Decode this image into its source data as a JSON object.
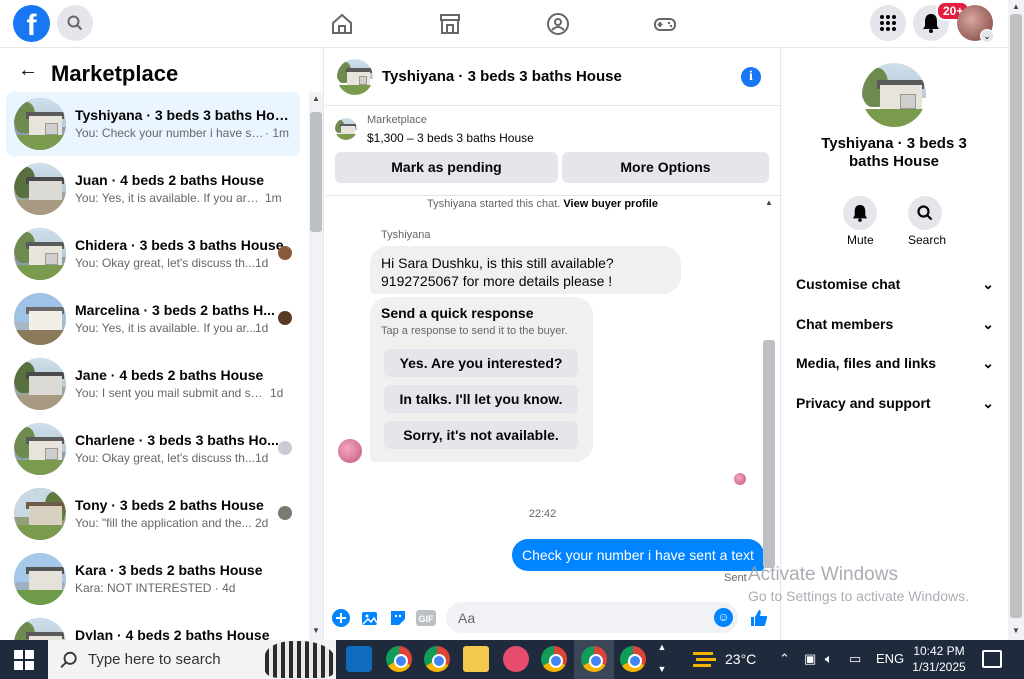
{
  "topbar": {
    "logo_letter": "f",
    "notifications_badge": "20+"
  },
  "left": {
    "title": "Marketplace",
    "conversations": [
      {
        "title": "Tyshiyana · 3 beds 3 baths House",
        "preview": "You: Check your number i have se...",
        "time": "· 1m"
      },
      {
        "title": "Juan · 4 beds 2 baths House",
        "preview": "You: Yes, it is available. If you are i...",
        "time": "1m"
      },
      {
        "title": "Chidera · 3 beds 3 baths House",
        "preview": "You: Okay great, let's discuss th...",
        "time": "1d"
      },
      {
        "title": "Marcelina · 3 beds 2 baths H...",
        "preview": "You: Yes, it is available. If you ar...",
        "time": "1d"
      },
      {
        "title": "Jane · 4 beds 2 baths House",
        "preview": "You: I sent you mail submit and se...",
        "time": "1d"
      },
      {
        "title": "Charlene · 3 beds 3 baths Ho...",
        "preview": "You: Okay great, let's discuss th...",
        "time": "1d"
      },
      {
        "title": "Tony · 3 beds 2 baths House",
        "preview": "You: \"fill the application and the...",
        "time": "2d"
      },
      {
        "title": "Kara · 3 beds 2 baths House",
        "preview": "Kara: NOT INTERESTED · 4d",
        "time": ""
      },
      {
        "title": "Dylan · 4 beds 2 baths House",
        "preview": "",
        "time": ""
      }
    ]
  },
  "chat": {
    "header_title": "Tyshiyana · 3 beds 3 baths House",
    "listing_source": "Marketplace",
    "listing_desc": "$1,300 – 3 beds 3 baths House",
    "mark_pending": "Mark as pending",
    "more_options": "More Options",
    "started_text": "Tyshiyana started this chat.",
    "view_buyer": "View buyer profile",
    "sender_name": "Tyshiyana",
    "incoming_line1": "Hi Sara Dushku, is this still available?",
    "incoming_line2": "9192725067 for more details please !",
    "quick_title": "Send a quick response",
    "quick_sub": "Tap a response to send it to the buyer.",
    "quick_options": [
      "Yes. Are you interested?",
      "In talks. I'll let you know.",
      "Sorry, it's not available."
    ],
    "time_separator": "22:42",
    "outgoing": "Check your number i have sent a text",
    "sent_label": "Sent",
    "composer_placeholder": "Aa"
  },
  "right": {
    "title": "Tyshiyana · 3 beds 3 baths House",
    "mute_label": "Mute",
    "search_label": "Search",
    "sections": [
      "Customise chat",
      "Chat members",
      "Media, files and links",
      "Privacy and support"
    ]
  },
  "watermark": {
    "line1": "Activate Windows",
    "line2": "Go to Settings to activate Windows."
  },
  "taskbar": {
    "search_placeholder": "Type here to search",
    "temperature": "23°C",
    "language": "ENG",
    "time": "10:42 PM",
    "date": "1/31/2025"
  }
}
